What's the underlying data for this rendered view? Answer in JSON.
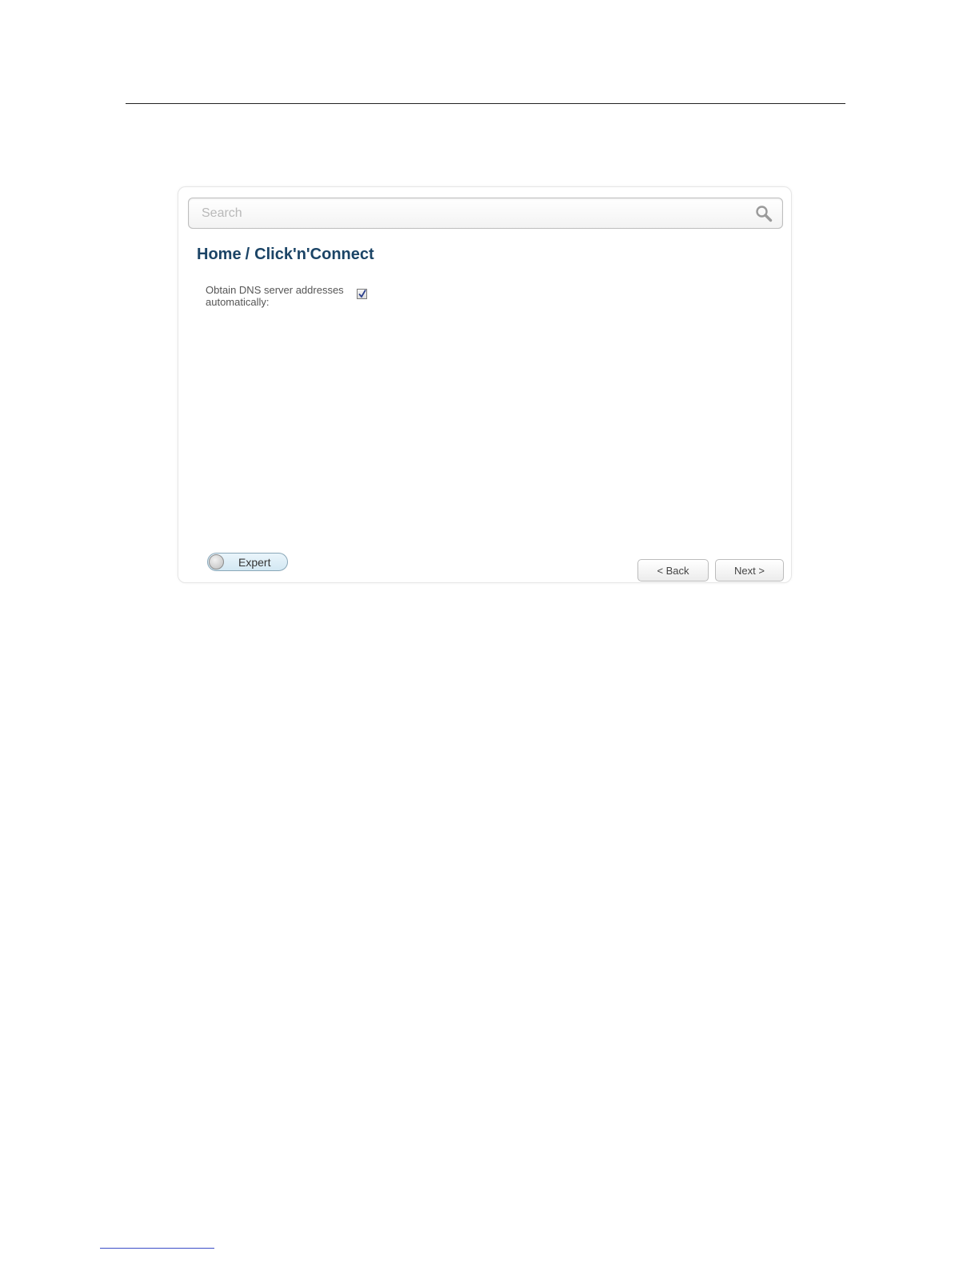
{
  "search": {
    "placeholder": "Search"
  },
  "breadcrumb": {
    "home": "Home",
    "separator": "/",
    "current": "Click'n'Connect"
  },
  "form": {
    "dns_auto_label": "Obtain DNS server addresses automatically:",
    "dns_auto_checked": true
  },
  "footer": {
    "expert_label": "Expert",
    "back_label": "< Back",
    "next_label": "Next >"
  },
  "colors": {
    "breadcrumb": "#1b4466",
    "toggle_fill": "#d3e8f3"
  },
  "icons": {
    "search": "search-icon",
    "checkbox": "checkmark-icon"
  }
}
